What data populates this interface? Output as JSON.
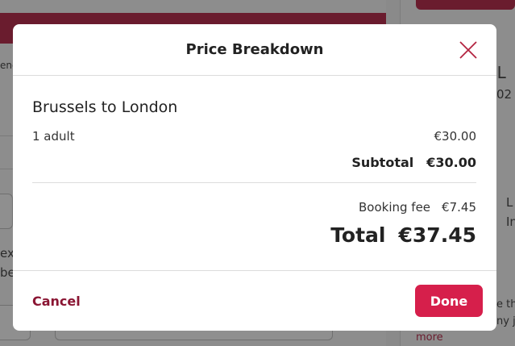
{
  "modal": {
    "title": "Price Breakdown",
    "close_icon": "close-x-icon",
    "route": "Brussels to London",
    "passenger_label": "1 adult",
    "passenger_price": "€30.00",
    "subtotal_label": "Subtotal",
    "subtotal_value": "€30.00",
    "booking_fee_label": "Booking fee",
    "booking_fee_value": "€7.45",
    "total_label": "Total",
    "total_value": "€37.45",
    "cancel_label": "Cancel",
    "done_label": "Done"
  },
  "background": {
    "left_text_1": "enc",
    "left_text_2": "ex",
    "left_text_3": "be",
    "right_title_fragment": "o L",
    "right_sub_fragment": "02",
    "right_text_1": "L",
    "right_text_2": "In",
    "right_text_3": "e thi",
    "right_text_4": "ny j",
    "right_link": "more"
  },
  "colors": {
    "accent": "#d61f4b",
    "cancel_text": "#8a1533",
    "overlay_brand": "#6a1c2e"
  }
}
